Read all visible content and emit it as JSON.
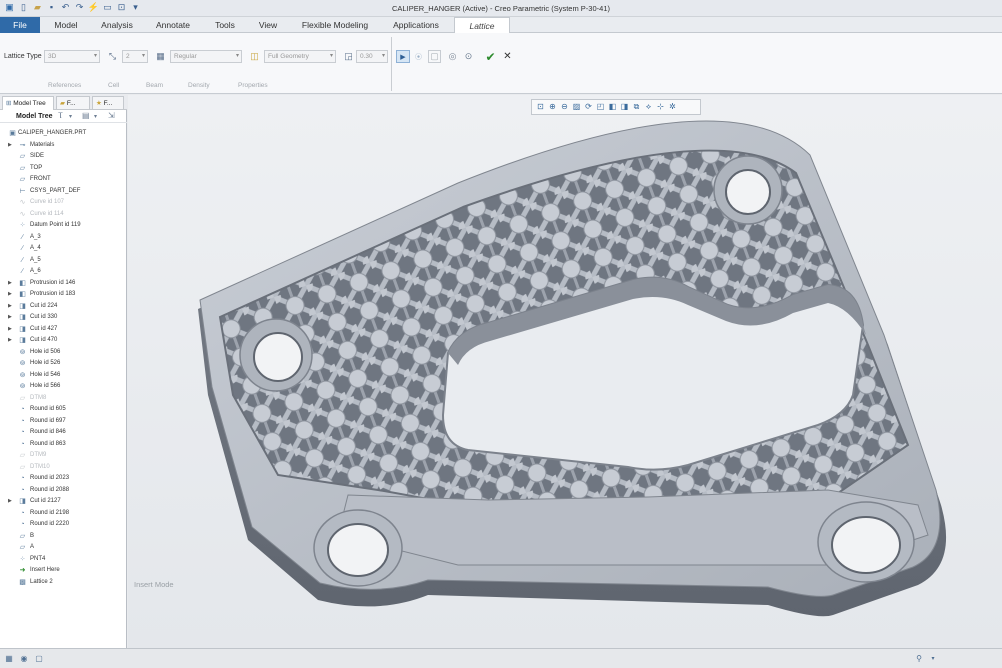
{
  "window": {
    "title": "CALIPER_HANGER (Active) - Creo Parametric (System P-30-41)"
  },
  "menu_tabs": [
    "File",
    "Model",
    "Analysis",
    "Annotate",
    "Tools",
    "View",
    "Flexible Modeling",
    "Applications",
    "Lattice"
  ],
  "ribbon": {
    "lattice_type_label": "Lattice Type",
    "lattice_type_value": "3D",
    "cell_count_value": "2",
    "cell_shape_value": "Regular",
    "geometry_value": "Full Geometry",
    "size_value": "0.30",
    "sections": [
      "References",
      "Cell",
      "Beam",
      "Density",
      "Properties"
    ]
  },
  "panel": {
    "tabs": [
      "Model Tree",
      "F...",
      "F..."
    ],
    "toolbar_label": "Model Tree"
  },
  "tree": {
    "root": "CALIPER_HANGER.PRT",
    "items": [
      {
        "label": "Materials",
        "icon": "materials-icon",
        "expandable": true,
        "muted": false
      },
      {
        "label": "SIDE",
        "icon": "datum-plane-icon",
        "expandable": false,
        "muted": false
      },
      {
        "label": "TOP",
        "icon": "datum-plane-icon",
        "expandable": false,
        "muted": false
      },
      {
        "label": "FRONT",
        "icon": "datum-plane-icon",
        "expandable": false,
        "muted": false
      },
      {
        "label": "CSYS_PART_DEF",
        "icon": "csys-icon",
        "expandable": false,
        "muted": false
      },
      {
        "label": "Curve id 107",
        "icon": "curve-icon",
        "expandable": false,
        "muted": true
      },
      {
        "label": "Curve id 114",
        "icon": "curve-icon",
        "expandable": false,
        "muted": true
      },
      {
        "label": "Datum Point id 119",
        "icon": "datum-point-icon",
        "expandable": false,
        "muted": false
      },
      {
        "label": "A_3",
        "icon": "datum-axis-icon",
        "expandable": false,
        "muted": false
      },
      {
        "label": "A_4",
        "icon": "datum-axis-icon",
        "expandable": false,
        "muted": false
      },
      {
        "label": "A_5",
        "icon": "datum-axis-icon",
        "expandable": false,
        "muted": false
      },
      {
        "label": "A_6",
        "icon": "datum-axis-icon",
        "expandable": false,
        "muted": false
      },
      {
        "label": "Protrusion id 146",
        "icon": "protrusion-icon",
        "expandable": true,
        "muted": false
      },
      {
        "label": "Protrusion id 183",
        "icon": "protrusion-icon",
        "expandable": true,
        "muted": false
      },
      {
        "label": "Cut id 224",
        "icon": "cut-icon",
        "expandable": true,
        "muted": false
      },
      {
        "label": "Cut id 330",
        "icon": "cut-icon",
        "expandable": true,
        "muted": false
      },
      {
        "label": "Cut id 427",
        "icon": "cut-icon",
        "expandable": true,
        "muted": false
      },
      {
        "label": "Cut id 470",
        "icon": "cut-icon",
        "expandable": true,
        "muted": false
      },
      {
        "label": "Hole id 506",
        "icon": "hole-icon",
        "expandable": false,
        "muted": false
      },
      {
        "label": "Hole id 526",
        "icon": "hole-icon",
        "expandable": false,
        "muted": false
      },
      {
        "label": "Hole id 546",
        "icon": "hole-icon",
        "expandable": false,
        "muted": false
      },
      {
        "label": "Hole id 566",
        "icon": "hole-icon",
        "expandable": false,
        "muted": false
      },
      {
        "label": "DTM8",
        "icon": "datum-plane-icon",
        "expandable": false,
        "muted": true
      },
      {
        "label": "Round id 605",
        "icon": "round-icon",
        "expandable": false,
        "muted": false
      },
      {
        "label": "Round id 697",
        "icon": "round-icon",
        "expandable": false,
        "muted": false
      },
      {
        "label": "Round id 846",
        "icon": "round-icon",
        "expandable": false,
        "muted": false
      },
      {
        "label": "Round id 863",
        "icon": "round-icon",
        "expandable": false,
        "muted": false
      },
      {
        "label": "DTM9",
        "icon": "datum-plane-icon",
        "expandable": false,
        "muted": true
      },
      {
        "label": "DTM10",
        "icon": "datum-plane-icon",
        "expandable": false,
        "muted": true
      },
      {
        "label": "Round id 2023",
        "icon": "round-icon",
        "expandable": false,
        "muted": false
      },
      {
        "label": "Round id 2088",
        "icon": "round-icon",
        "expandable": false,
        "muted": false
      },
      {
        "label": "Cut id 2127",
        "icon": "cut-icon",
        "expandable": true,
        "muted": false
      },
      {
        "label": "Round id 2198",
        "icon": "round-icon",
        "expandable": false,
        "muted": false
      },
      {
        "label": "Round id 2220",
        "icon": "round-icon",
        "expandable": false,
        "muted": false
      },
      {
        "label": "B",
        "icon": "datum-plane-icon",
        "expandable": false,
        "muted": false
      },
      {
        "label": "A",
        "icon": "datum-plane-icon",
        "expandable": false,
        "muted": false
      },
      {
        "label": "PNT4",
        "icon": "datum-point-icon",
        "expandable": false,
        "muted": false
      },
      {
        "label": "Insert Here",
        "icon": "insert-arrow-icon",
        "expandable": false,
        "muted": false
      },
      {
        "label": "Lattice 2",
        "icon": "lattice-icon",
        "expandable": false,
        "muted": false
      }
    ]
  },
  "viewport": {
    "mode_text": "Insert Mode"
  },
  "colors": {
    "file_tab": "#2f6aa8",
    "model_body": "#8b919b",
    "accept_green": "#2c8a2c"
  }
}
